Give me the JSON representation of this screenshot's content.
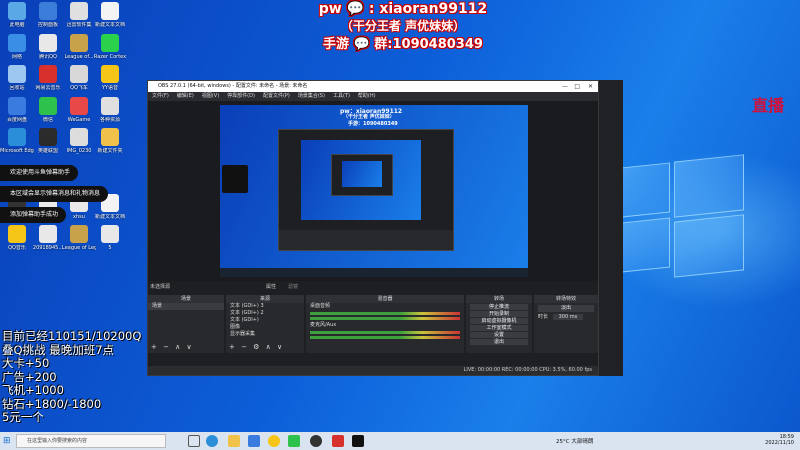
{
  "overlay": {
    "line1": "pw 💬 : xiaoran99112",
    "line2": "（干分王者 声优妹妹）",
    "line3": "手游 💬 群:1090480349",
    "zhibo": "直播"
  },
  "desktop_icons": [
    {
      "label": "此电脑",
      "color": "#5aa9e6"
    },
    {
      "label": "控制面板",
      "color": "#3b7dd8"
    },
    {
      "label": "迅雷软件集",
      "color": "#e0e0e0"
    },
    {
      "label": "新建文本文档",
      "color": "#f4f4f4"
    },
    {
      "label": "网络",
      "color": "#3a8ee6"
    },
    {
      "label": "腾讯QQ",
      "color": "#e8e8e8"
    },
    {
      "label": "League of...",
      "color": "#c8a24a"
    },
    {
      "label": "Razer Cortex",
      "color": "#2ad14a"
    },
    {
      "label": "回收站",
      "color": "#9ec7ef"
    },
    {
      "label": "网易云音乐",
      "color": "#d8302c"
    },
    {
      "label": "QQ飞车",
      "color": "#d8d8d8"
    },
    {
      "label": "YY语音",
      "color": "#f5c518"
    },
    {
      "label": "百度网盘",
      "color": "#3a7be0"
    },
    {
      "label": "微信",
      "color": "#2ec24d"
    },
    {
      "label": "WeGame",
      "color": "#e84848"
    },
    {
      "label": "各种资源",
      "color": "#e0e0e0"
    },
    {
      "label": "Microsoft Edge",
      "color": "#2a8fd8"
    },
    {
      "label": "英雄联盟",
      "color": "#2b2b2b"
    },
    {
      "label": "IMG_0230",
      "color": "#dddddd"
    },
    {
      "label": "新建文件夹",
      "color": "#f0c24a"
    },
    {
      "label": "OBS Studio",
      "color": "#333333"
    },
    {
      "label": "334151...",
      "color": "#e8e8e8"
    },
    {
      "label": "xhsu",
      "color": "#e8e8e8"
    },
    {
      "label": "新建文本文档",
      "color": "#f4f4f4"
    },
    {
      "label": "QQ音乐",
      "color": "#f5c518"
    },
    {
      "label": "20918945...",
      "color": "#e8e8e8"
    },
    {
      "label": "League of Legends",
      "color": "#c8a24a"
    },
    {
      "label": "5",
      "color": "#e8e8e8"
    }
  ],
  "bubbles": [
    "欢迎使用斗鱼弹幕助手",
    "本区域会显示弹幕消息和礼物消息",
    "添加弹幕助手成功"
  ],
  "stats": [
    "目前已经110151/10200Q",
    "叠Q挑战 最晚加班7点",
    "大卡+50",
    "广告+200",
    "飞机+1000",
    "钻石+1800/-1800",
    "5元一个"
  ],
  "obs": {
    "title": "OBS 27.0.1 (64-bit, windows) - 配置文件: 未命名 - 场景: 未命名",
    "menu": [
      "文件(F)",
      "编辑(E)",
      "视图(V)",
      "停靠部件(D)",
      "配置文件(P)",
      "场景集合(S)",
      "工具(T)",
      "帮助(H)"
    ],
    "inner_overlay": "pw：xiaoran99112",
    "inner_overlay2": "（干分王者 声优妹妹）",
    "inner_overlay3": "手游：1090480349",
    "source_none": "未选择源",
    "props_btn": "属性",
    "filter_btn": "滤镜",
    "docks": {
      "scenes": {
        "title": "场景",
        "items": [
          "场景"
        ]
      },
      "sources": {
        "title": "来源",
        "items": [
          "文本 (GDI+) 3",
          "文本 (GDI+) 2",
          "文本 (GDI+)",
          "图像",
          "显示器采集"
        ]
      },
      "mixer": {
        "title": "混音器",
        "channels": [
          "桌面音频",
          "麦克风/Aux"
        ]
      },
      "transitions": {
        "title": "转场",
        "items": [
          "停止推流",
          "开始录制",
          "启动虚拟摄像机",
          "工作室模式",
          "设置",
          "退出"
        ]
      },
      "controls": {
        "title": "转场特效",
        "fade": "淡出",
        "duration_label": "时长",
        "duration": "300 ms"
      }
    },
    "status": "LIVE: 00:00:00   REC: 00:00:00   CPU: 3.5%, 60.00 fps"
  },
  "taskbar": {
    "search_placeholder": "在这里输入你要搜索的内容",
    "weather": "25°C 大部晴朗",
    "time": "18:59",
    "date": "2022/11/10"
  }
}
